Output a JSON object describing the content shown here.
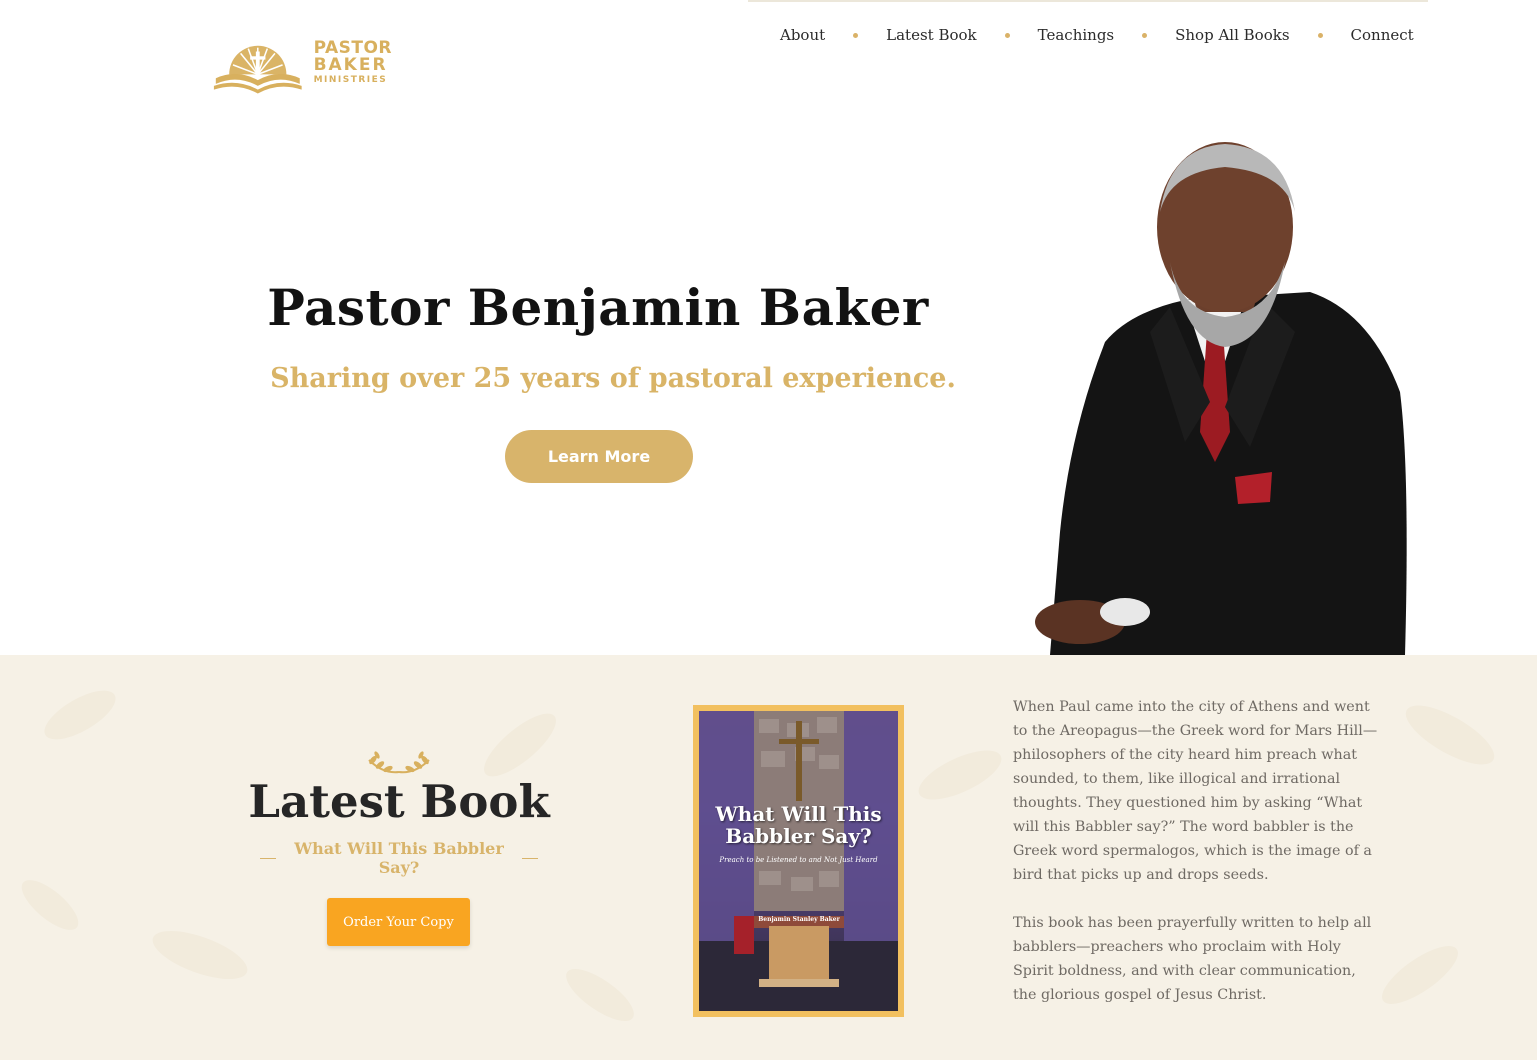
{
  "header": {
    "logo": {
      "line1": "PASTOR",
      "line2": "BAKER",
      "line3": "MINISTRIES"
    },
    "nav": [
      {
        "label": "About"
      },
      {
        "label": "Latest Book"
      },
      {
        "label": "Teachings"
      },
      {
        "label": "Shop All Books"
      },
      {
        "label": "Connect"
      }
    ]
  },
  "hero": {
    "title": "Pastor Benjamin Baker",
    "subtitle": "Sharing over 25 years of pastoral experience.",
    "button_label": "Learn More"
  },
  "latest_book": {
    "heading": "Latest Book",
    "subtitle": "What Will This Babbler Say?",
    "button_label": "Order Your Copy",
    "cover": {
      "title_line1": "What Will This",
      "title_line2": "Babbler Say?",
      "tagline": "Preach to be Listened to and Not Just Heard",
      "author": "Benjamin Stanley Baker"
    },
    "description": [
      "When Paul came into the city of Athens and went to the Areopagus—the Greek word for Mars Hill—philosophers of the city heard him preach what sounded, to them, like illogical and irrational thoughts. They questioned him by asking “What will this Babbler say?” The word babbler is the Greek word spermalogos, which is the image of a bird that picks up and drops seeds.",
      "This book has been prayerfully written to help all babblers—preachers who proclaim with Holy Spirit boldness, and with clear communication, the glorious gospel of Jesus Christ."
    ]
  },
  "colors": {
    "gold": "#d8b46b",
    "orange_button": "#f9a521",
    "section_bg": "#f6f1e6"
  }
}
